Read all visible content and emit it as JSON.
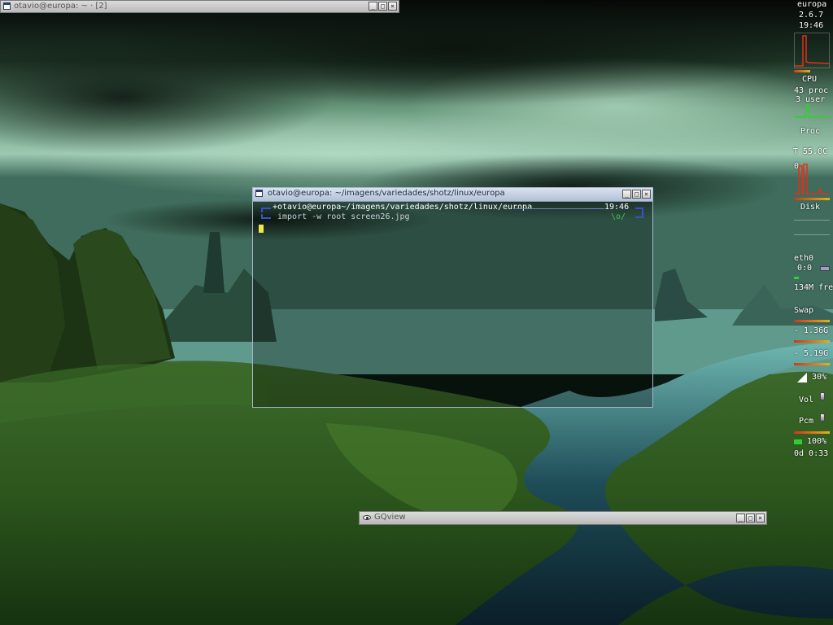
{
  "desktop": {
    "wallpaper": "alien-landscape-green",
    "accent": "#3a50c8",
    "cursor_color": "#f2e64a"
  },
  "windows": {
    "top_terminal": {
      "title": "otavio@europa: ~ · [2]",
      "icon": "terminal-icon"
    },
    "main_terminal": {
      "title": "otavio@europa: ~/imagens/variedades/shotz/linux/europa",
      "prompt": "+otavio@europa~/imagens/variedades/shotz/linux/europa",
      "clock": "19:46",
      "command": "import -w root screen26.jpg",
      "status": "\\o/",
      "icon": "terminal-icon"
    },
    "gqview": {
      "title": "GQview",
      "icon": "eye-icon"
    },
    "buttons": {
      "minimize": "_",
      "maximize": "□",
      "close": "×"
    }
  },
  "gkrellm": {
    "hostname": "europa",
    "kernel": "2.6.7",
    "clock": "19:46",
    "cpu_label": "CPU",
    "procs": "43 proc",
    "users": "3 user",
    "proc_label": "Proc",
    "temp": "T 55.0C",
    "disk_zero": "0",
    "disk_label": "Disk",
    "net_iface": "eth0",
    "net_rate": "0:0",
    "mem_free": "134M fre",
    "swap_label": "Swap",
    "fs1": "- 1.36G",
    "fs2": "- 5.19G",
    "battery": "30%",
    "vol_label": "Vol",
    "pcm_label": "Pcm",
    "power": "100%",
    "uptime": "0d 0:33"
  }
}
